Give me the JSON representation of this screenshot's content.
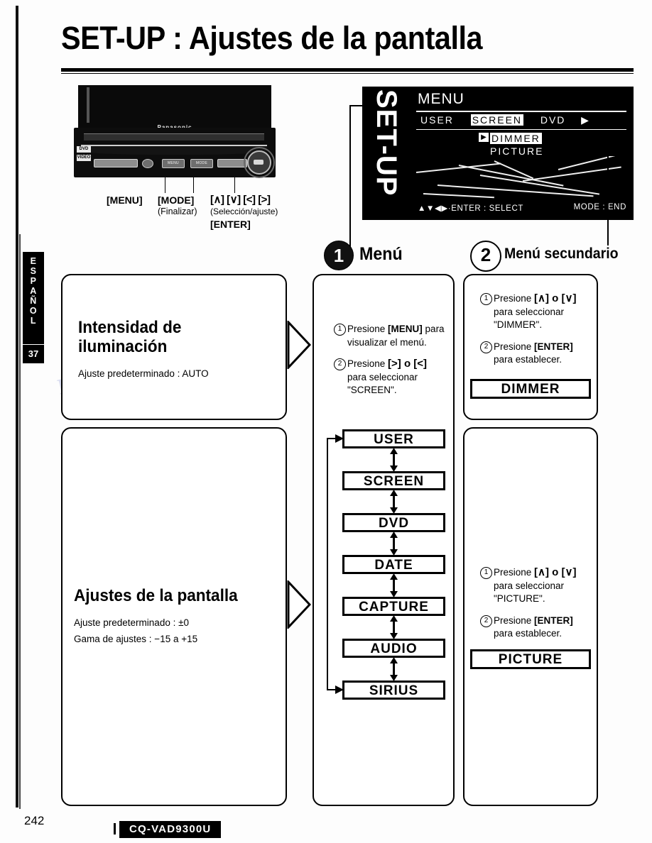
{
  "page": {
    "title": "SET-UP : Ajustes de la pantalla",
    "number": "242",
    "model": "CQ-VAD9300U",
    "language_tab": {
      "letters": [
        "E",
        "S",
        "P",
        "A",
        "Ñ",
        "O",
        "L"
      ],
      "number": "37"
    },
    "watermark": "manualsolib.com"
  },
  "device": {
    "brand": "Panasonic",
    "badges": [
      "DVD",
      "VIDEO"
    ],
    "buttons": [
      "MENU",
      "MODE"
    ],
    "key_labels": {
      "menu": "[MENU]",
      "mode": "[MODE]",
      "mode_sub": "(Finalizar)",
      "arrows": "[∧] [∨] [<] [>]",
      "arrows_sub": "(Selección/ajuste)",
      "enter": "[ENTER]"
    }
  },
  "osd": {
    "side_label": "SET-UP",
    "title": "MENU",
    "tabs": [
      "USER",
      "SCREEN",
      "DVD"
    ],
    "selected_tab": "SCREEN",
    "tabs_more": "▶",
    "items": [
      "DIMMER",
      "PICTURE"
    ],
    "selected_item": "DIMMER",
    "marker": "▶",
    "footer_left": "▲▼◀▶·ENTER : SELECT",
    "footer_right": "MODE : END"
  },
  "steps": [
    {
      "num": "1",
      "heading": "Menú",
      "style": "filled"
    },
    {
      "num": "2",
      "heading": "Menú secundario",
      "style": "hollow"
    }
  ],
  "left_boxes": [
    {
      "title": "Intensidad de iluminación",
      "lines": [
        "Ajuste predeterminado : AUTO"
      ]
    },
    {
      "title": "Ajustes de la pantalla",
      "lines": [
        "Ajuste predeterminado : ±0",
        "Gama de ajustes : −15 a +15"
      ]
    }
  ],
  "menu_column": {
    "instructions": [
      {
        "num": "1",
        "parts": [
          "Presione ",
          "[MENU]",
          " para visualizar el menú."
        ],
        "bold_index": 1
      },
      {
        "num": "2",
        "parts": [
          "Presione ",
          "[>] o [<]",
          " para seleccionar \"SCREEN\"."
        ],
        "bold_index": 1
      }
    ],
    "chain": [
      "USER",
      "SCREEN",
      "DVD",
      "DATE",
      "CAPTURE",
      "AUDIO",
      "SIRIUS"
    ]
  },
  "submenu_column": {
    "blocks": [
      {
        "instructions": [
          {
            "num": "1",
            "lead": "Presione ",
            "key": "[∧] o [∨]",
            "tail": " para seleccionar \"DIMMER\"."
          },
          {
            "num": "2",
            "lead": "Presione ",
            "key": "[ENTER]",
            "tail": " para establecer."
          }
        ],
        "result": "DIMMER"
      },
      {
        "instructions": [
          {
            "num": "1",
            "lead": "Presione ",
            "key": "[∧] o [∨]",
            "tail": " para seleccionar \"PICTURE\"."
          },
          {
            "num": "2",
            "lead": "Presione ",
            "key": "[ENTER]",
            "tail": " para establecer."
          }
        ],
        "result": "PICTURE"
      }
    ]
  }
}
